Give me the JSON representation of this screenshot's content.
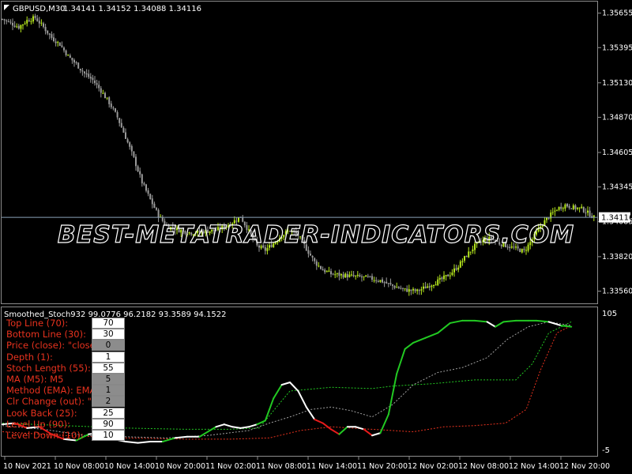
{
  "window": {
    "symbol_label": "GBPUSD,M30",
    "ohlc": "1.34141 1.34152 1.34088 1.34116",
    "current_price": "1.34116",
    "watermark": "BEST-METATRADER-INDICATORS.COM"
  },
  "indicator": {
    "label": "Smoothed_Stoch932 99.0776 96.2182 93.3589 94.1522",
    "scale_max": "105",
    "scale_min": "-5",
    "params": [
      {
        "label": "Top Line (70):",
        "value": "70",
        "grey": false
      },
      {
        "label": "Bottom Line (30):",
        "value": "30",
        "grey": false
      },
      {
        "label": "Price (close): \"close\"",
        "value": "0",
        "grey": true
      },
      {
        "label": "Depth (1):",
        "value": "1",
        "grey": false
      },
      {
        "label": "Stoch Length (55):",
        "value": "55",
        "grey": false
      },
      {
        "label": "MA (M5): M5",
        "value": "5",
        "grey": true
      },
      {
        "label": "Method (EMA): EMA",
        "value": "1",
        "grey": true
      },
      {
        "label": "Clr Change (out): \"out",
        "value": "2",
        "grey": true
      },
      {
        "label": "Look Back (25):",
        "value": "25",
        "grey": false
      },
      {
        "label": "Level Up (90):",
        "value": "90",
        "grey": false
      },
      {
        "label": "Level Down (10):",
        "value": "10",
        "grey": false
      }
    ]
  },
  "colors": {
    "background": "#000000",
    "bull_candle": "#b5e61d",
    "bear_candle": "#9a9a9a",
    "price_line": "#8aa2b8",
    "stoch_up": "#22c922",
    "stoch_down": "#e81b1b",
    "stoch_neutral": "#ffffff",
    "level_up_line": "#22c922",
    "level_mid_line": "#a0a0a0",
    "level_down_line": "#e8321e",
    "param_text": "#e8321e"
  },
  "chart_data": [
    {
      "type": "candlestick",
      "title": "GBPUSD,M30",
      "y_ticks": [
        "1.35655",
        "1.35395",
        "1.35130",
        "1.34870",
        "1.34605",
        "1.34345",
        "1.34085",
        "1.33820",
        "1.33560"
      ],
      "ylim": [
        1.3348,
        1.3573
      ],
      "current_price": 1.34116,
      "close_path": [
        [
          0,
          1.3561
        ],
        [
          4,
          1.3558
        ],
        [
          8,
          1.3555
        ],
        [
          12,
          1.356
        ],
        [
          16,
          1.3562
        ],
        [
          20,
          1.3555
        ],
        [
          24,
          1.3547
        ],
        [
          28,
          1.3542
        ],
        [
          32,
          1.3533
        ],
        [
          36,
          1.3527
        ],
        [
          40,
          1.352
        ],
        [
          44,
          1.3515
        ],
        [
          48,
          1.3507
        ],
        [
          52,
          1.3498
        ],
        [
          56,
          1.3487
        ],
        [
          60,
          1.3472
        ],
        [
          64,
          1.3456
        ],
        [
          68,
          1.3438
        ],
        [
          72,
          1.3425
        ],
        [
          76,
          1.3413
        ],
        [
          80,
          1.3405
        ],
        [
          86,
          1.3402
        ],
        [
          92,
          1.34
        ],
        [
          98,
          1.3401
        ],
        [
          104,
          1.3402
        ],
        [
          110,
          1.3406
        ],
        [
          116,
          1.3412
        ],
        [
          120,
          1.3401
        ],
        [
          124,
          1.339
        ],
        [
          128,
          1.3387
        ],
        [
          132,
          1.3392
        ],
        [
          136,
          1.3398
        ],
        [
          140,
          1.3402
        ],
        [
          144,
          1.3398
        ],
        [
          148,
          1.3388
        ],
        [
          152,
          1.3378
        ],
        [
          156,
          1.3372
        ],
        [
          160,
          1.3369
        ],
        [
          166,
          1.3368
        ],
        [
          172,
          1.3367
        ],
        [
          178,
          1.3366
        ],
        [
          184,
          1.3364
        ],
        [
          190,
          1.336
        ],
        [
          196,
          1.3357
        ],
        [
          202,
          1.3356
        ],
        [
          206,
          1.3359
        ],
        [
          210,
          1.3362
        ],
        [
          214,
          1.3365
        ],
        [
          218,
          1.3369
        ],
        [
          222,
          1.3375
        ],
        [
          226,
          1.3383
        ],
        [
          230,
          1.339
        ],
        [
          234,
          1.3394
        ],
        [
          238,
          1.3396
        ],
        [
          242,
          1.3392
        ],
        [
          246,
          1.339
        ],
        [
          250,
          1.3388
        ],
        [
          254,
          1.3386
        ],
        [
          258,
          1.3395
        ],
        [
          262,
          1.3405
        ],
        [
          266,
          1.3412
        ],
        [
          270,
          1.3418
        ],
        [
          274,
          1.3421
        ],
        [
          278,
          1.3419
        ],
        [
          282,
          1.3418
        ],
        [
          286,
          1.3414
        ],
        [
          288,
          1.34116
        ]
      ]
    },
    {
      "type": "line",
      "title": "Smoothed_Stoch932",
      "values_shown": [
        99.0776,
        96.2182,
        93.3589,
        94.1522
      ],
      "ylim": [
        -5,
        105
      ],
      "x": [
        "10 Nov 2021",
        "10 Nov 08:00",
        "10 Nov 14:00",
        "10 Nov 20:00",
        "11 Nov 02:00",
        "11 Nov 08:00",
        "11 Nov 14:00",
        "11 Nov 20:00",
        "12 Nov 02:00",
        "12 Nov 08:00",
        "12 Nov 14:00",
        "12 Nov 20:00"
      ],
      "main_line": [
        [
          0,
          16
        ],
        [
          6,
          17
        ],
        [
          12,
          13
        ],
        [
          18,
          14
        ],
        [
          24,
          8
        ],
        [
          30,
          4
        ],
        [
          36,
          3
        ],
        [
          42,
          8
        ],
        [
          48,
          9
        ],
        [
          54,
          4
        ],
        [
          60,
          2
        ],
        [
          66,
          1
        ],
        [
          72,
          2
        ],
        [
          78,
          2
        ],
        [
          84,
          5
        ],
        [
          90,
          6
        ],
        [
          96,
          6
        ],
        [
          100,
          10
        ],
        [
          104,
          14
        ],
        [
          108,
          16
        ],
        [
          112,
          14
        ],
        [
          116,
          13
        ],
        [
          120,
          14
        ],
        [
          124,
          16
        ],
        [
          128,
          19
        ],
        [
          132,
          37
        ],
        [
          136,
          48
        ],
        [
          140,
          50
        ],
        [
          144,
          43
        ],
        [
          148,
          30
        ],
        [
          152,
          20
        ],
        [
          156,
          17
        ],
        [
          160,
          12
        ],
        [
          164,
          8
        ],
        [
          168,
          14
        ],
        [
          172,
          14
        ],
        [
          176,
          12
        ],
        [
          180,
          7
        ],
        [
          184,
          9
        ],
        [
          188,
          24
        ],
        [
          192,
          57
        ],
        [
          196,
          77
        ],
        [
          200,
          82
        ],
        [
          206,
          86
        ],
        [
          212,
          90
        ],
        [
          218,
          98
        ],
        [
          224,
          100
        ],
        [
          230,
          100
        ],
        [
          236,
          99
        ],
        [
          240,
          95
        ],
        [
          244,
          99
        ],
        [
          250,
          100
        ],
        [
          256,
          100
        ],
        [
          260,
          100
        ],
        [
          266,
          99
        ],
        [
          272,
          96
        ],
        [
          277,
          95
        ]
      ],
      "signal_dotted_grey": [
        [
          0,
          15
        ],
        [
          20,
          12
        ],
        [
          40,
          7
        ],
        [
          60,
          6
        ],
        [
          80,
          5
        ],
        [
          100,
          7
        ],
        [
          120,
          11
        ],
        [
          130,
          17
        ],
        [
          140,
          22
        ],
        [
          150,
          28
        ],
        [
          160,
          30
        ],
        [
          170,
          27
        ],
        [
          180,
          22
        ],
        [
          190,
          32
        ],
        [
          200,
          48
        ],
        [
          212,
          58
        ],
        [
          224,
          62
        ],
        [
          236,
          70
        ],
        [
          246,
          85
        ],
        [
          256,
          95
        ],
        [
          266,
          99
        ],
        [
          277,
          96
        ]
      ],
      "level_up_dotted_green": [
        [
          0,
          17
        ],
        [
          30,
          15
        ],
        [
          60,
          13
        ],
        [
          90,
          12
        ],
        [
          110,
          12
        ],
        [
          125,
          13
        ],
        [
          140,
          43
        ],
        [
          160,
          46
        ],
        [
          180,
          45
        ],
        [
          190,
          47
        ],
        [
          200,
          48
        ],
        [
          210,
          49
        ],
        [
          230,
          52
        ],
        [
          250,
          52
        ],
        [
          258,
          65
        ],
        [
          266,
          90
        ],
        [
          277,
          99
        ]
      ],
      "level_down_dotted_red": [
        [
          0,
          10
        ],
        [
          30,
          7
        ],
        [
          60,
          5
        ],
        [
          90,
          4
        ],
        [
          110,
          4
        ],
        [
          130,
          5
        ],
        [
          145,
          11
        ],
        [
          160,
          14
        ],
        [
          180,
          12
        ],
        [
          200,
          10
        ],
        [
          215,
          14
        ],
        [
          230,
          15
        ],
        [
          245,
          17
        ],
        [
          255,
          28
        ],
        [
          262,
          60
        ],
        [
          270,
          90
        ],
        [
          277,
          96
        ]
      ],
      "upper_scale": "105",
      "lower_scale": "-5"
    }
  ]
}
